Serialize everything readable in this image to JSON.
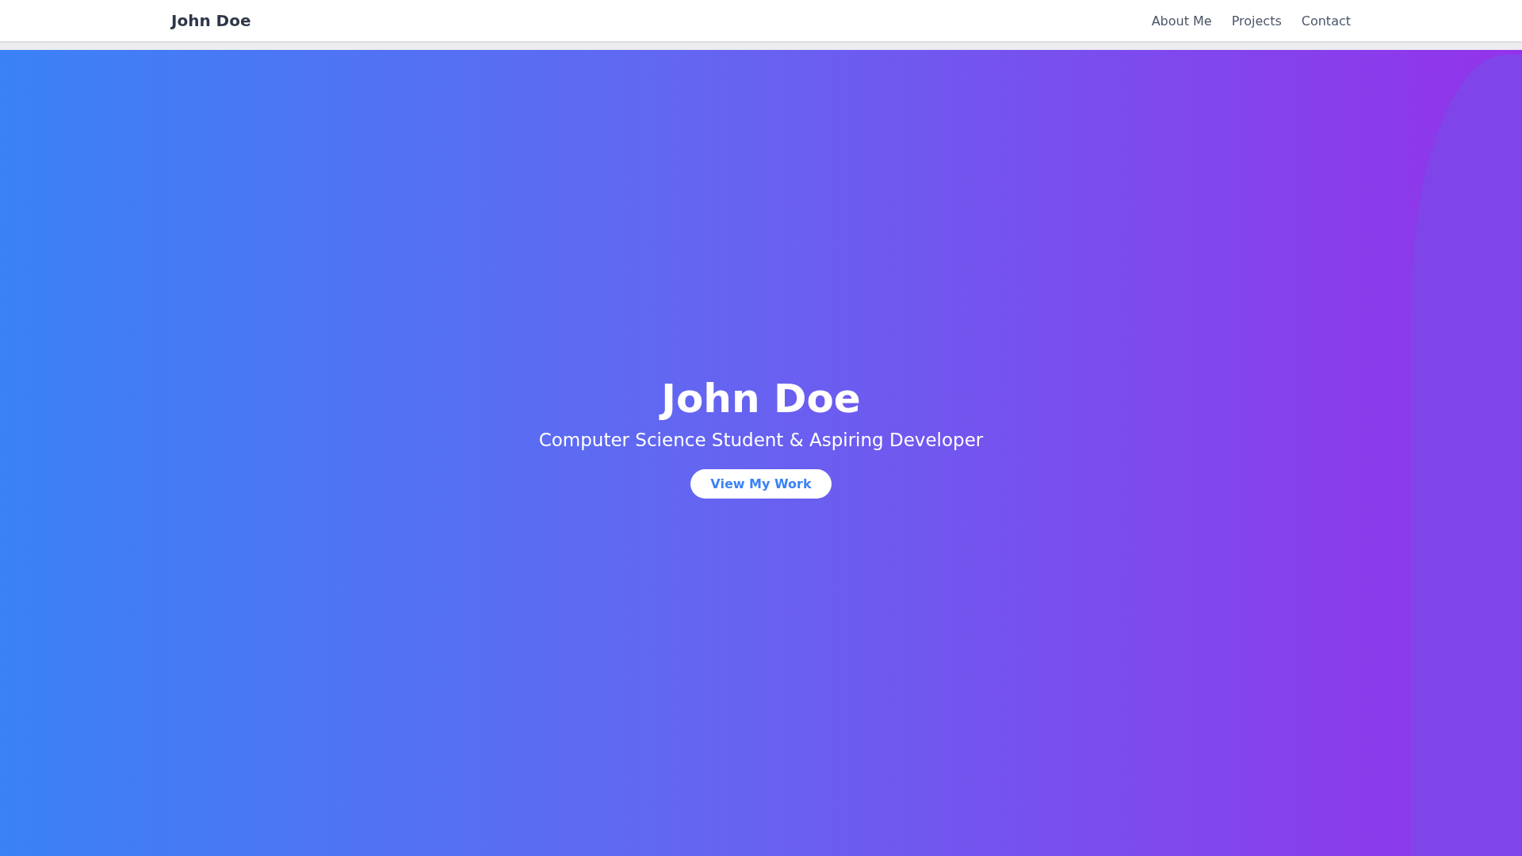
{
  "navbar": {
    "brand": "John Doe",
    "links": [
      {
        "label": "About Me"
      },
      {
        "label": "Projects"
      },
      {
        "label": "Contact"
      }
    ]
  },
  "hero": {
    "title": "John Doe",
    "subtitle": "Computer Science Student & Aspiring Developer",
    "button": "View My Work"
  }
}
